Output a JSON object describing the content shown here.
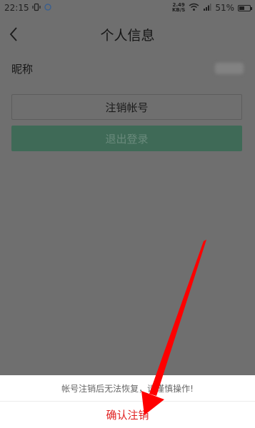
{
  "status_bar": {
    "time": "22:15",
    "net_speed": "2.49",
    "net_unit": "KB/S",
    "battery": "51%",
    "battery_level": 0.51
  },
  "nav": {
    "title": "个人信息"
  },
  "profile": {
    "nickname_label": "昵称"
  },
  "buttons": {
    "cancel_account": "注销帐号",
    "logout": "退出登录"
  },
  "sheet": {
    "message": "帐号注销后无法恢复，请谨慎操作!",
    "confirm": "确认注销"
  },
  "colors": {
    "overlay": "#6f6f6f",
    "logout_bg": "#3f6a57",
    "confirm_text": "#e02020",
    "arrow": "#ff0000"
  },
  "icons": [
    "vibrate-icon",
    "circle-icon",
    "wifi-icon",
    "signal-icon",
    "battery-icon",
    "back-icon",
    "annotation-arrow"
  ]
}
